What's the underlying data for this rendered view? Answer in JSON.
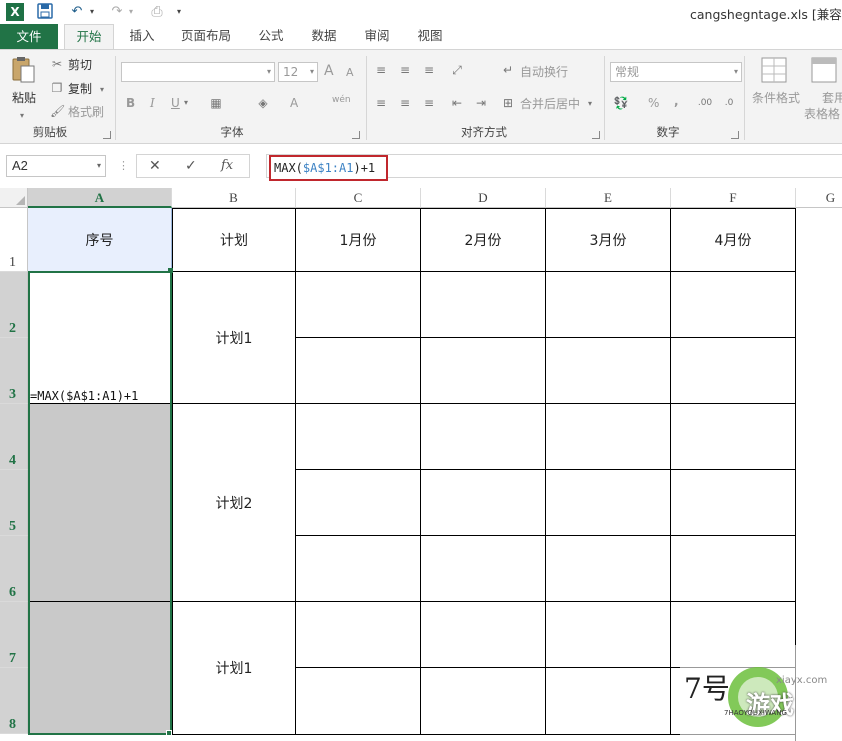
{
  "titlebar": {
    "app_icon": "X",
    "doc_title": "cangshegntage.xls  [兼容模",
    "icons": [
      "excel-logo-icon",
      "save-icon",
      "undo-icon",
      "redo-icon",
      "print-preview-icon"
    ]
  },
  "tabs": [
    "文件",
    "开始",
    "插入",
    "页面布局",
    "公式",
    "数据",
    "审阅",
    "视图"
  ],
  "ribbon": {
    "clipboard": {
      "paste": "粘贴",
      "cut": "剪切",
      "copy": "复制",
      "format_painter": "格式刷",
      "label": "剪贴板"
    },
    "font": {
      "font_name": "",
      "font_size": "12",
      "grow": "A",
      "shrink": "A",
      "bold": "B",
      "italic": "I",
      "underline": "U",
      "font_color": "A",
      "phonetic": "wén",
      "label": "字体"
    },
    "alignment": {
      "wrap_text": "自动换行",
      "merge_center": "合并后居中",
      "label": "对齐方式"
    },
    "number": {
      "format": "常规",
      "percent": "%",
      "comma": ",",
      "label": "数字"
    },
    "styles": {
      "conditional": "条件格式",
      "format_table_line1": "套用",
      "format_table_line2": "表格格"
    }
  },
  "formula_bar": {
    "name_box": "A2",
    "cancel": "✕",
    "enter": "✓",
    "fx": "fx",
    "formula_parts": [
      "MAX(",
      "$A$1:A1",
      ")+1"
    ]
  },
  "grid": {
    "columns": [
      "A",
      "B",
      "C",
      "D",
      "E",
      "F",
      "G"
    ],
    "rows": [
      "1",
      "2",
      "3",
      "4",
      "5",
      "6",
      "7",
      "8"
    ],
    "header": [
      "序号",
      "计划",
      "1月份",
      "2月份",
      "3月份",
      "4月份"
    ],
    "plans": [
      "计划1",
      "计划2",
      "计划1"
    ],
    "cell_formula": "=MAX($A$1:A1)+1"
  },
  "watermark": {
    "text1": "7号",
    "text2": "游戏",
    "small": "7HAOYOUXIWANG",
    "url": "xiayx.com"
  },
  "colors": {
    "excel_green": "#217346",
    "formula_highlight": "#c0272d",
    "reference_blue": "#3c82c4"
  }
}
